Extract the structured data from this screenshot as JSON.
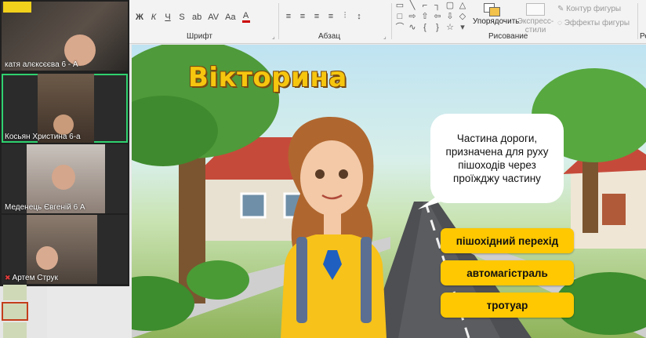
{
  "ribbon": {
    "font_group_label": "Шрифт",
    "paragraph_group_label": "Абзац",
    "drawing_group_label": "Рисование",
    "edit_group_label": "Ре",
    "arrange_label": "Упорядочить",
    "express_styles_label": "Экспресс-стили",
    "shape_outline_label": "Контур фигуры",
    "shape_effects_label": "Эффекты фигуры",
    "font_buttons": [
      "Ж",
      "К",
      "Ч",
      "S",
      "ab",
      "AV",
      "Aa",
      "A"
    ],
    "paragraph_buttons": [
      "≡",
      "≡",
      "≡",
      "≡",
      "⫶",
      "↕"
    ]
  },
  "participants": [
    {
      "name": "катя алєксєєва 6 - А",
      "active": false,
      "muted": false
    },
    {
      "name": "Косьян Христина 6-а",
      "active": true,
      "muted": false
    },
    {
      "name": "Меденець Євгеній 6 А",
      "active": false,
      "muted": false
    },
    {
      "name": "Артем Струк",
      "active": false,
      "muted": true
    }
  ],
  "slide": {
    "title": "Вікторина",
    "question": "Частина дороги, призначена для руху пішоходів через проїжджу частину",
    "answers": [
      "пішохідний перехід",
      "автомагістраль",
      "тротуар"
    ]
  },
  "colors": {
    "title_fill": "#f6c60f",
    "answer_fill": "#ffc800",
    "active_speaker": "#2fd16f"
  }
}
